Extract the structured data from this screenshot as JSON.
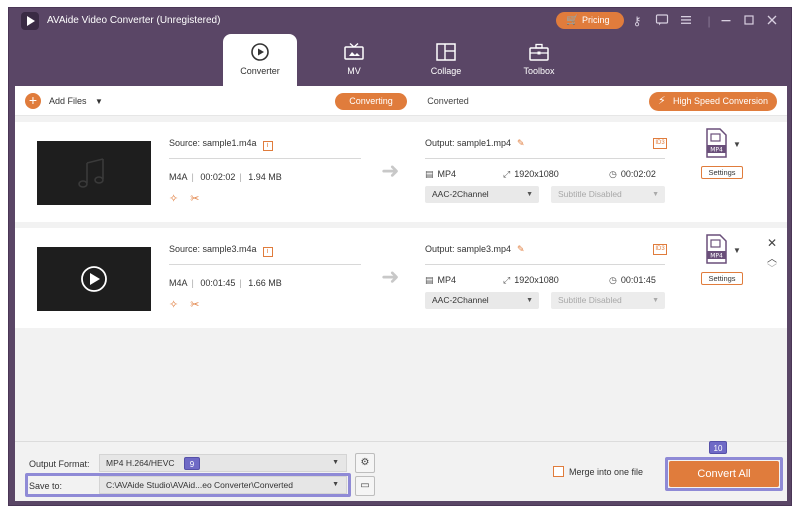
{
  "titlebar": {
    "app_title": "AVAide Video Converter (Unregistered)",
    "pricing_label": "Pricing",
    "icons": [
      "key-icon",
      "chat-icon",
      "menu-icon",
      "minimize-icon",
      "maximize-icon",
      "close-icon"
    ]
  },
  "tabs": [
    {
      "label": "Converter",
      "active": true
    },
    {
      "label": "MV",
      "active": false
    },
    {
      "label": "Collage",
      "active": false
    },
    {
      "label": "Toolbox",
      "active": false
    }
  ],
  "toolbar": {
    "add_files": "Add Files",
    "converting": "Converting",
    "converted": "Converted",
    "high_speed": "High Speed Conversion"
  },
  "files": [
    {
      "source": "Source: sample1.m4a",
      "format": "M4A",
      "duration": "00:02:02",
      "size": "1.94 MB",
      "output": "Output: sample1.mp4",
      "out_format": "MP4",
      "resolution": "1920x1080",
      "out_duration": "00:02:02",
      "audio": "AAC-2Channel",
      "subtitle": "Subtitle Disabled",
      "format_badge": "MP4",
      "settings": "Settings"
    },
    {
      "source": "Source: sample3.m4a",
      "format": "M4A",
      "duration": "00:01:45",
      "size": "1.66 MB",
      "output": "Output: sample3.mp4",
      "out_format": "MP4",
      "resolution": "1920x1080",
      "out_duration": "00:01:45",
      "audio": "AAC-2Channel",
      "subtitle": "Subtitle Disabled",
      "format_badge": "MP4",
      "settings": "Settings"
    }
  ],
  "bottom": {
    "output_format_label": "Output Format:",
    "output_format_value": "MP4 H.264/HEVC",
    "save_to_label": "Save to:",
    "save_to_value": "C:\\AVAide Studio\\AVAid...eo Converter\\Converted",
    "merge_label": "Merge into one file",
    "convert_all": "Convert All",
    "badge_save": "9",
    "badge_convert": "10"
  },
  "colors": {
    "accent": "#e07c3c",
    "window": "#5a4666",
    "highlight": "#8f8ad6"
  }
}
